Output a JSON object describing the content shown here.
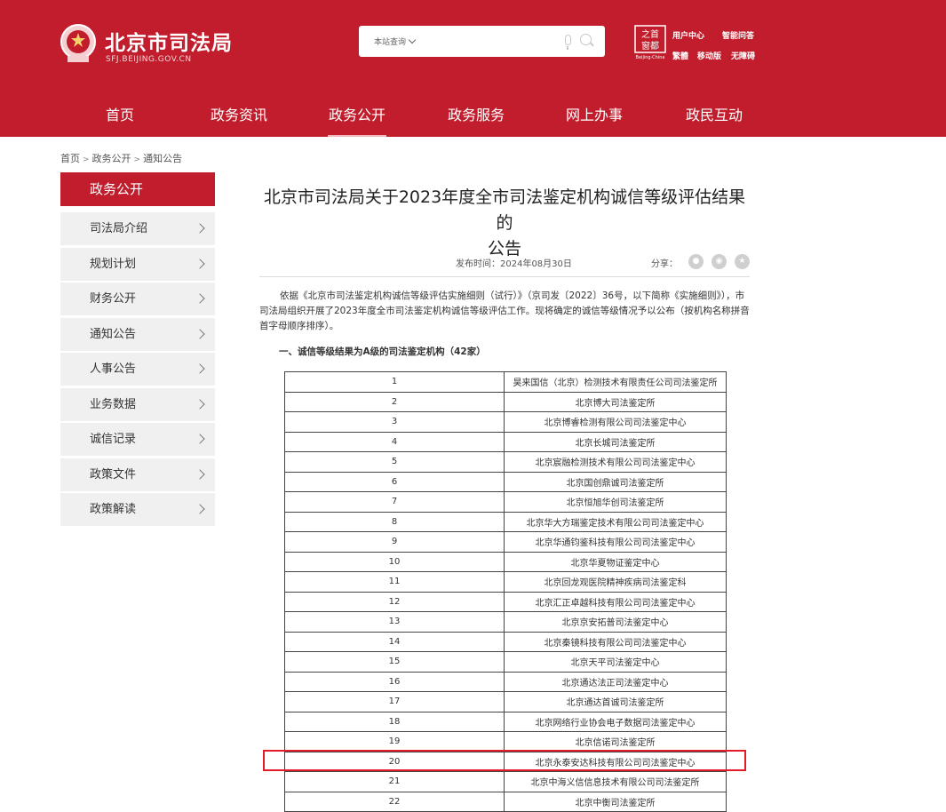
{
  "header": {
    "site_title": "北京市司法局",
    "site_domain": "SFJ.BEIJING.GOV.CN",
    "search": {
      "scope_label": "本站查询",
      "placeholder": ""
    },
    "capital_logo_text": [
      "之首",
      "窗都",
      "Beijing·China"
    ],
    "links": [
      "用户中心",
      "智能问答",
      "繁體",
      "移动版",
      "无障碍"
    ],
    "brand_color": "#c21d2c"
  },
  "nav": {
    "items": [
      "首页",
      "政务资讯",
      "政务公开",
      "政务服务",
      "网上办事",
      "政民互动"
    ],
    "active": "政务公开"
  },
  "breadcrumb": {
    "items": [
      "首页",
      "政务公开",
      "通知公告"
    ],
    "separator": ">"
  },
  "sidebar": {
    "title": "政务公开",
    "items": [
      "司法局介绍",
      "规划计划",
      "财务公开",
      "通知公告",
      "人事公告",
      "业务数据",
      "诚信记录",
      "政策文件",
      "政策解读"
    ]
  },
  "article": {
    "title_line1": "北京市司法局关于2023年度全市司法鉴定机构诚信等级评估结果的",
    "title_line2": "公告",
    "publish_label": "发布时间：",
    "publish_date": "2024年08月30日",
    "share_label": "分享：",
    "share_icons": [
      "wechat-icon",
      "weibo-icon",
      "favorite-icon"
    ],
    "intro": "依据《北京市司法鉴定机构诚信等级评估实施细则（试行）》（京司发〔2022〕36号，以下简称《实施细则》），市司法局组织开展了2023年度全市司法鉴定机构诚信等级评估工作。现将确定的诚信等级情况予以公布（按机构名称拼音首字母顺序排序）。",
    "section_heading": "一、诚信等级结果为A级的司法鉴定机构（42家）",
    "rows": [
      {
        "no": "1",
        "name": "昊来国信（北京）检测技术有限责任公司司法鉴定所"
      },
      {
        "no": "2",
        "name": "北京博大司法鉴定所"
      },
      {
        "no": "3",
        "name": "北京博睿检测有限公司司法鉴定中心"
      },
      {
        "no": "4",
        "name": "北京长城司法鉴定所"
      },
      {
        "no": "5",
        "name": "北京宸融检测技术有限公司司法鉴定中心"
      },
      {
        "no": "6",
        "name": "北京国创鼎诚司法鉴定所"
      },
      {
        "no": "7",
        "name": "北京恒旭华创司法鉴定所"
      },
      {
        "no": "8",
        "name": "北京华大方瑞鉴定技术有限公司司法鉴定中心"
      },
      {
        "no": "9",
        "name": "北京华通钧鉴科技有限公司司法鉴定中心"
      },
      {
        "no": "10",
        "name": "北京华夏物证鉴定中心"
      },
      {
        "no": "11",
        "name": "北京回龙观医院精神疾病司法鉴定科"
      },
      {
        "no": "12",
        "name": "北京汇正卓越科技有限公司司法鉴定中心"
      },
      {
        "no": "13",
        "name": "北京京安拓普司法鉴定中心"
      },
      {
        "no": "14",
        "name": "北京秦镜科技有限公司司法鉴定中心"
      },
      {
        "no": "15",
        "name": "北京天平司法鉴定中心"
      },
      {
        "no": "16",
        "name": "北京通达法正司法鉴定中心"
      },
      {
        "no": "17",
        "name": "北京通达首诚司法鉴定所"
      },
      {
        "no": "18",
        "name": "北京网络行业协会电子数据司法鉴定中心"
      },
      {
        "no": "19",
        "name": "北京信诺司法鉴定所"
      },
      {
        "no": "20",
        "name": "北京永泰安达科技有限公司司法鉴定中心"
      },
      {
        "no": "21",
        "name": "北京中海义信信息技术有限公司司法鉴定所"
      },
      {
        "no": "22",
        "name": "北京中衡司法鉴定所"
      }
    ],
    "highlighted_row": "20",
    "highlight_color": "#e21a2a"
  }
}
